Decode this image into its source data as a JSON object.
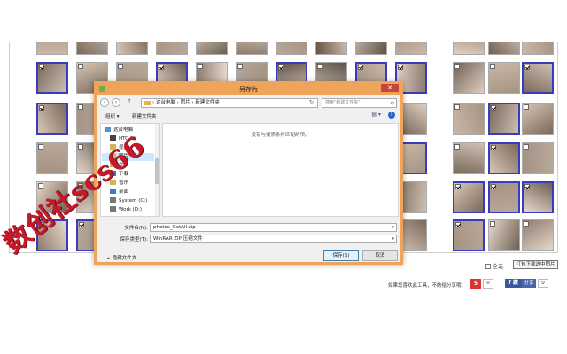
{
  "dialog": {
    "title": "另存为",
    "close_label": "✕",
    "nav": {
      "back": "‹",
      "forward": "›",
      "up": "↑"
    },
    "breadcrumb": "› 这台电脑 › 图片 › 新建文件夹",
    "search_placeholder": "搜索\"新建文件夹\"",
    "organize_label": "组织 ▾",
    "new_folder_label": "新建文件夹",
    "empty_message": "没有与搜索条件匹配的项。",
    "tree": [
      {
        "label": "这台电脑",
        "icon": "computer-icon",
        "color": "#5a8fd6"
      },
      {
        "label": "HTC 8X",
        "icon": "phone-icon",
        "color": "#444444"
      },
      {
        "label": "视频",
        "icon": "video-folder-icon",
        "color": "#d9b05a"
      },
      {
        "label": "图片",
        "icon": "pictures-folder-icon",
        "color": "#d9b05a",
        "selected": true
      },
      {
        "label": "文档",
        "icon": "documents-folder-icon",
        "color": "#d9b05a"
      },
      {
        "label": "下载",
        "icon": "downloads-folder-icon",
        "color": "#3a78c8"
      },
      {
        "label": "音乐",
        "icon": "music-folder-icon",
        "color": "#d9b05a"
      },
      {
        "label": "桌面",
        "icon": "desktop-folder-icon",
        "color": "#3a78c8"
      },
      {
        "label": "System (C:)",
        "icon": "drive-icon",
        "color": "#777777"
      },
      {
        "label": "Work (D:)",
        "icon": "drive-icon",
        "color": "#777777"
      }
    ],
    "filename_label": "文件名(N):",
    "filename_value": "photos_GetAll.zip",
    "filetype_label": "保存类型(T):",
    "filetype_value": "WinRAR ZIP 压缩文件",
    "hide_folders_label": "隐藏文件夹",
    "save_label": "保存(S)",
    "cancel_label": "取消"
  },
  "page": {
    "select_all_label": "全选",
    "download_label": "打包下载选中图片",
    "tools_note": "如果您喜欢此工具，不妨给分享哦：",
    "rating_count": "0",
    "fb_label": "f 讚",
    "share_label": "分享",
    "share_count": "0"
  },
  "watermark": "数创社scs66"
}
